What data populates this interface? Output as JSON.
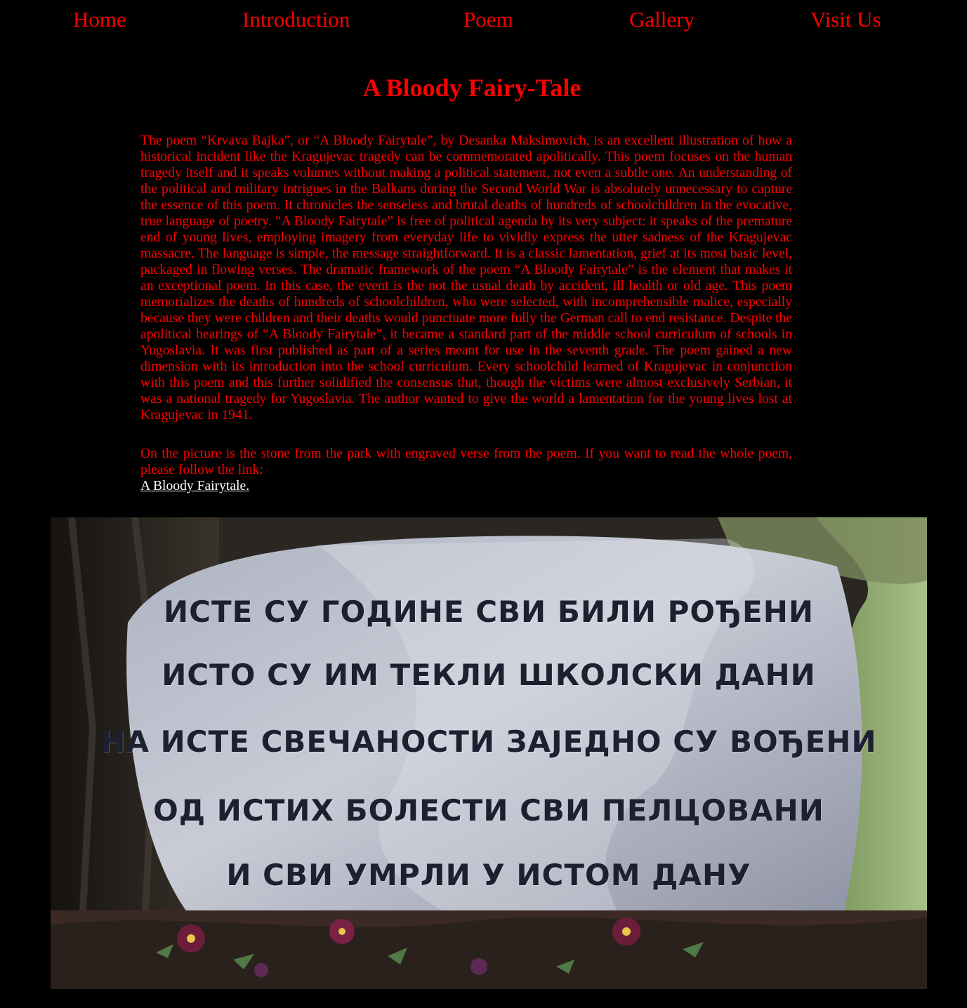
{
  "nav": {
    "items": [
      {
        "label": "Home"
      },
      {
        "label": "Introduction"
      },
      {
        "label": "Poem"
      },
      {
        "label": "Gallery"
      },
      {
        "label": "Visit Us"
      }
    ]
  },
  "page": {
    "title": "A Bloody Fairy-Tale"
  },
  "content": {
    "intro": "The poem “Krvava Bajka”, or “A Bloody Fairytale”, by Desanka Maksimovich, is an excellent illustration of how a historical incident like the Kragujevac tragedy can be commemorated apolitically. This poem focuses on the human tragedy itself and it speaks volumes without making a political statement, not even a subtle one. An understanding of the political and military intrigues in the Balkans during the Second World War is absolutely unnecessary to capture the essence of this poem. It chronicles the senseless and brutal deaths of hundreds of schoolchildren in the evocative, true language of poetry. “A Bloody Fairytale” is free of political agenda by its very subject: it speaks of the premature end of young lives, employing imagery from everyday life to vividly express the utter sadness of the Kragujevac massacre. The language is simple, the message straightforward. It is a classic lamentation, grief at its most basic level, packaged in flowing verses. The dramatic framework of the poem “A Bloody Fairytale” is the element that makes it an exceptional poem. In this case, the event is the not the usual death by accident, ill health or old age. This poem memorializes the deaths of hundreds of schoolchildren, who were selected, with incomprehensible malice, especially because they were children and their deaths would punctuate more fully the German call to end resistance. Despite the apolitical bearings of “A Bloody Fairytale”, it became a standard part of the middle school curriculum of schools in Yugoslavia. It was first published as part of a series meant for use in the seventh grade. The poem gained a new dimension with its introduction into the school curriculum. Every schoolchild learned of Kragujevac in conjunction with this poem and this further solidified the consensus that, though the victims were almost exclusively Serbian, it was a national tragedy for Yugoslavia. The author wanted to give the world a lamentation for the young lives lost at Kragujevac in 1941.",
    "picture_note": "On the picture is the stone from the park with engraved verse from the poem. If you want to read the whole poem, please follow the link:",
    "poem_link": "A Bloody Fairytale."
  },
  "stone": {
    "verses": [
      "ИСТЕ СУ ГОДИНЕ СВИ БИЛИ РОЂЕНИ",
      "ИСТО СУ ИМ ТЕКЛИ ШКОЛСКИ ДАНИ",
      "НА ИСТЕ СВЕЧАНОСТИ ЗАЈЕДНО СУ ВОЂЕНИ",
      "ОД ИСТИХ БОЛЕСТИ СВИ ПЕЛЦОВАНИ",
      "И СВИ УМРЛИ У ИСТОМ ДАНУ"
    ]
  },
  "colors": {
    "background": "#000000",
    "text": "#ff0000",
    "link": "#ffffff"
  }
}
